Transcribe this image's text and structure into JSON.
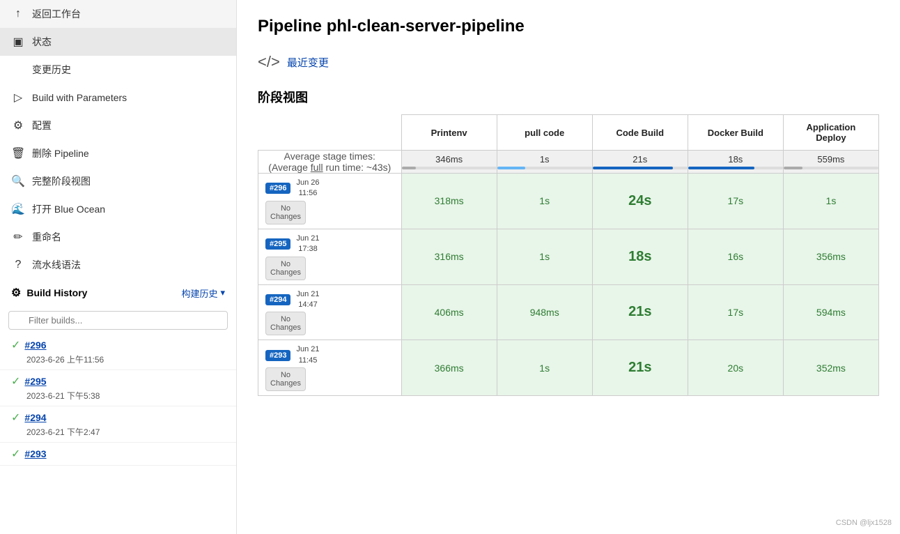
{
  "sidebar": {
    "nav_items": [
      {
        "id": "back",
        "icon": "↑",
        "label": "返回工作台",
        "active": false
      },
      {
        "id": "status",
        "icon": "☐",
        "label": "状态",
        "active": true
      },
      {
        "id": "changes",
        "icon": "</>",
        "label": "变更历史",
        "active": false
      },
      {
        "id": "build_params",
        "icon": "▷",
        "label": "Build with Parameters",
        "active": false
      },
      {
        "id": "config",
        "icon": "⚙",
        "label": "配置",
        "active": false
      },
      {
        "id": "delete",
        "icon": "🗑",
        "label": "删除 Pipeline",
        "active": false
      },
      {
        "id": "full_stage",
        "icon": "🔍",
        "label": "完整阶段视图",
        "active": false
      },
      {
        "id": "blue_ocean",
        "icon": "🌊",
        "label": "打开 Blue Ocean",
        "active": false
      },
      {
        "id": "rename",
        "icon": "✏",
        "label": "重命名",
        "active": false
      },
      {
        "id": "pipeline_syntax",
        "icon": "?",
        "label": "流水线语法",
        "active": false
      }
    ],
    "build_history_label": "Build History",
    "build_history_label_cn": "构建历史",
    "filter_placeholder": "Filter builds...",
    "builds": [
      {
        "id": "#296",
        "date": "2023-6-26 上午11:56",
        "url": "#296"
      },
      {
        "id": "#295",
        "date": "2023-6-21 下午5:38",
        "url": "#295"
      },
      {
        "id": "#294",
        "date": "2023-6-21 下午2:47",
        "url": "#294"
      },
      {
        "id": "#293",
        "date": "",
        "url": "#293"
      }
    ]
  },
  "main": {
    "page_title": "Pipeline phl-clean-server-pipeline",
    "change_icon": "</>",
    "change_link_text": "最近变更",
    "stage_section_title": "阶段视图",
    "avg_row": {
      "label_line1": "Average stage times:",
      "label_line2": "(Average full run time: ~43s)",
      "full_underline": "full",
      "stages": [
        {
          "time": "346ms",
          "progress": 15,
          "color": "#aaa"
        },
        {
          "time": "1s",
          "progress": 30,
          "color": "#64b5f6"
        },
        {
          "time": "21s",
          "progress": 85,
          "color": "#1565c0"
        },
        {
          "time": "18s",
          "progress": 70,
          "color": "#1565c0"
        },
        {
          "time": "559ms",
          "progress": 20,
          "color": "#aaa"
        }
      ]
    },
    "stage_headers": [
      "Printenv",
      "pull code",
      "Code Build",
      "Docker Build",
      "Application Deploy"
    ],
    "build_rows": [
      {
        "badge": "#296",
        "date": "Jun 26",
        "time": "11:56",
        "no_changes": "No\nChanges",
        "stages": [
          "318ms",
          "1s",
          "24s",
          "17s",
          "1s"
        ],
        "large": [
          false,
          false,
          true,
          false,
          false
        ]
      },
      {
        "badge": "#295",
        "date": "Jun 21",
        "time": "17:38",
        "no_changes": "No\nChanges",
        "stages": [
          "316ms",
          "1s",
          "18s",
          "16s",
          "356ms"
        ],
        "large": [
          false,
          false,
          true,
          false,
          false
        ]
      },
      {
        "badge": "#294",
        "date": "Jun 21",
        "time": "14:47",
        "no_changes": "No\nChanges",
        "stages": [
          "406ms",
          "948ms",
          "21s",
          "17s",
          "594ms"
        ],
        "large": [
          false,
          false,
          true,
          false,
          false
        ]
      },
      {
        "badge": "#293",
        "date": "Jun 21",
        "time": "11:45",
        "no_changes": "No\nChanges",
        "stages": [
          "366ms",
          "1s",
          "21s",
          "20s",
          "352ms"
        ],
        "large": [
          false,
          false,
          true,
          false,
          false
        ]
      }
    ]
  },
  "watermark": "CSDN @ljx1528"
}
